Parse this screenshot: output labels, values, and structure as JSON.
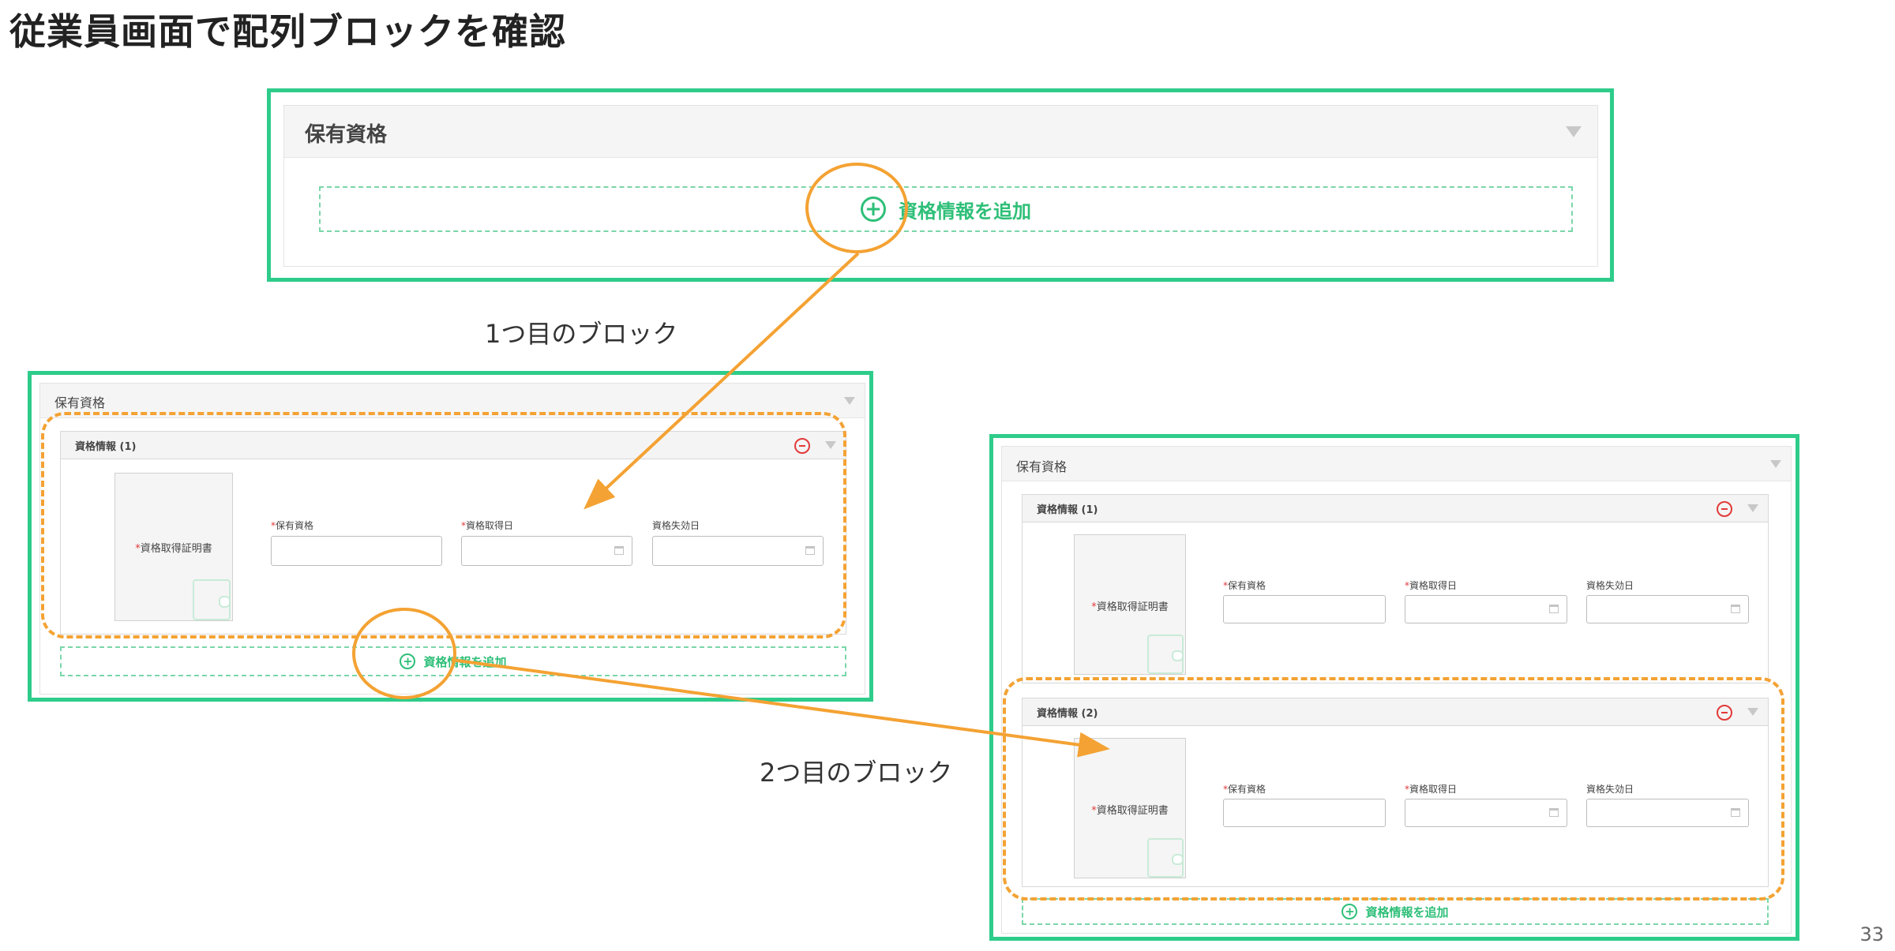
{
  "slide_title": "従業員画面で配列ブロックを確認",
  "page_number": "33",
  "captions": {
    "first_block": "1つ目のブロック",
    "second_block": "2つ目のブロック"
  },
  "section": {
    "title": "保有資格"
  },
  "add_button": {
    "label": "資格情報を追加"
  },
  "card": {
    "titles": [
      "資格情報 (1)",
      "資格情報 (2)"
    ],
    "required_mark": "*",
    "photo_label": "資格取得証明書",
    "fields": {
      "qualification": "保有資格",
      "acquired_date": "資格取得日",
      "expiry_date": "資格失効日"
    }
  },
  "colors": {
    "frame_green": "#2ecc8a",
    "annotation_orange": "#f4a233",
    "remove_red": "#e23a3a",
    "add_green": "#2ebf78"
  },
  "icons": [
    "add-circle-icon",
    "remove-circle-icon",
    "collapse-triangle-icon",
    "calendar-icon",
    "wallet-icon"
  ]
}
